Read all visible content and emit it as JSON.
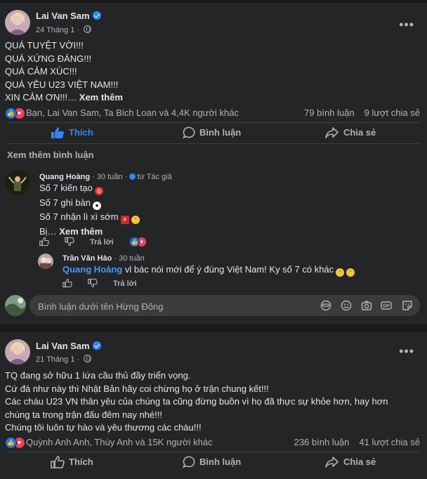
{
  "posts": [
    {
      "author": "Lai Van Sam",
      "date": "24 Tháng 1",
      "body": [
        "QUÁ TUYỆT VỜI!!!",
        "QUÁ XỨNG ĐÁNG!!!",
        "QUÁ CẢM XÚC!!!",
        "QUÁ YÊU U23 VIỆT NAM!!!",
        "XIN CẢM ƠN!!!…"
      ],
      "see_more": "Xem thêm",
      "reaction_names": "Bạn, Lai Van Sam, Ta Bich Loan và 4,4K người khác",
      "comment_count": "79 bình luận",
      "share_count": "9 lượt chia sẻ",
      "actions": {
        "like": "Thích",
        "comment": "Bình luận",
        "share": "Chia sẻ"
      },
      "view_more_comments": "Xem thêm bình luận",
      "comment": {
        "author": "Quang Hoàng",
        "time": "30 tuần",
        "badge": "từ Tác giả",
        "lines": [
          "Số 7 kiến tạo",
          "Số 7 ghi bàn",
          "Số 7 nhận lì xì sớm",
          "Bị…"
        ],
        "see_more": "Xem thêm",
        "reply_label": "Trả lời"
      },
      "reply": {
        "author": "Trần Văn Hào",
        "time": "30 tuần",
        "mention": "Quang Hoàng",
        "text": "vl bác nói mới để ý đúng Việt Nam! Ky số 7 có khác",
        "reply_label": "Trả lời"
      },
      "write_placeholder": "Bình luận dưới tên Hừng Đông"
    },
    {
      "author": "Lai Van Sam",
      "date": "21 Tháng 1",
      "body": [
        "TQ đang sở hữu 1 lứa cầu thủ đầy triển vọng.",
        "Cứ đá như này thì Nhật Bản hãy coi chừng họ ở trận chung kết!!!",
        "Các cháu U23 VN thân yêu của chúng ta cũng đừng buồn vì họ đã thực sự khỏe hơn, hay hơn",
        "chúng ta trong trận đấu đêm nay nhé!!!",
        "Chúng tôi luôn tự hào và  yêu thương các cháu!!!"
      ],
      "reaction_names": "Quỳnh Anh Anh, Thùy Anh và 15K người khác",
      "comment_count": "236 bình luận",
      "share_count": "41 lượt chia sẻ",
      "actions": {
        "like": "Thích",
        "comment": "Bình luận",
        "share": "Chia sẻ"
      }
    }
  ],
  "colors": {
    "background": "#18191a",
    "card": "#242526",
    "accent": "#2d88ff",
    "link_blue": "#4599ff",
    "like_blue": "#1877f2",
    "love_red": "#f33e58"
  }
}
